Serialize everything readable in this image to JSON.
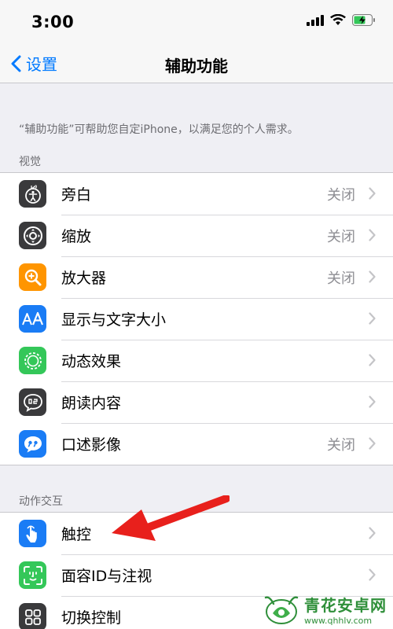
{
  "status": {
    "time": "3:00"
  },
  "nav": {
    "back_label": "设置",
    "title": "辅助功能"
  },
  "intro": "“辅助功能”可帮助您自定iPhone，以满足您的个人需求。",
  "sections": [
    {
      "header": "视觉",
      "rows": [
        {
          "label": "旁白",
          "value": "关闭",
          "icon": "voiceover-icon",
          "color": "#3a3a3c"
        },
        {
          "label": "缩放",
          "value": "关闭",
          "icon": "zoom-icon",
          "color": "#3a3a3c"
        },
        {
          "label": "放大器",
          "value": "关闭",
          "icon": "magnifier-icon",
          "color": "#ff9500"
        },
        {
          "label": "显示与文字大小",
          "value": "",
          "icon": "text-size-icon",
          "color": "#1a7cf5"
        },
        {
          "label": "动态效果",
          "value": "",
          "icon": "motion-icon",
          "color": "#34c759"
        },
        {
          "label": "朗读内容",
          "value": "",
          "icon": "spoken-content-icon",
          "color": "#3a3a3c"
        },
        {
          "label": "口述影像",
          "value": "关闭",
          "icon": "audio-description-icon",
          "color": "#1a7cf5"
        }
      ]
    },
    {
      "header": "动作交互",
      "rows": [
        {
          "label": "触控",
          "value": "",
          "icon": "touch-icon",
          "color": "#1a7cf5"
        },
        {
          "label": "面容ID与注视",
          "value": "",
          "icon": "face-id-icon",
          "color": "#34c759"
        },
        {
          "label": "切换控制",
          "value": "",
          "icon": "switch-control-icon",
          "color": "#3a3a3c"
        }
      ]
    }
  ],
  "watermark": {
    "title": "青花安卓网",
    "url": "www.qhhlv.com"
  }
}
